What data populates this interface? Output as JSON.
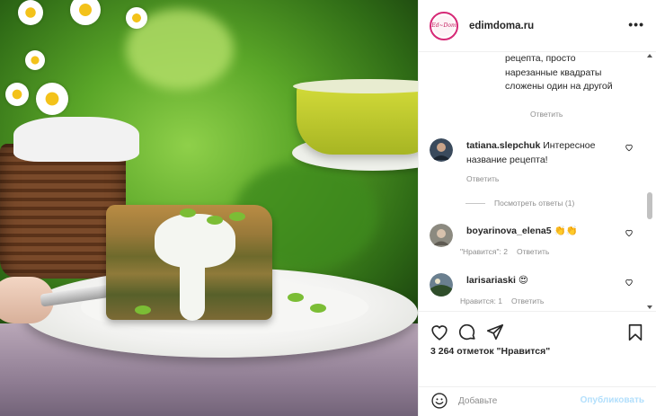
{
  "header": {
    "username": "edimdoma.ru",
    "avatar_text": "Ed~Dom",
    "more_label": "•••"
  },
  "caption": {
    "continued_text": "рецепта, просто нарезанные квадраты сложены один на другой",
    "reply_label": "Ответить"
  },
  "comments": [
    {
      "username": "tatiana.slepchuk",
      "text": "Интересное название рецепта!",
      "reply_label": "Ответить",
      "likes_label": "",
      "view_replies_label": "Посмотреть ответы (1)"
    },
    {
      "username": "boyarinova_elena5",
      "text": "👏👏",
      "likes_label": "\"Нравится\": 2",
      "reply_label": "Ответить"
    },
    {
      "username": "larisariaski",
      "text": "😍",
      "likes_label": "Нравится: 1",
      "reply_label": "Ответить"
    }
  ],
  "actions": {
    "like_icon": "heart-icon",
    "comment_icon": "comment-icon",
    "share_icon": "share-icon",
    "save_icon": "bookmark-icon"
  },
  "likes_count_text": "3 264 отметок \"Нравится\"",
  "add_comment": {
    "placeholder": "Добавьте",
    "publish_label": "Опубликовать",
    "emoji_icon": "emoji-icon"
  },
  "colors": {
    "accent_disabled": "#b2dffc",
    "text_primary": "#262626",
    "text_secondary": "#8e8e8e",
    "divider": "#efefef"
  }
}
